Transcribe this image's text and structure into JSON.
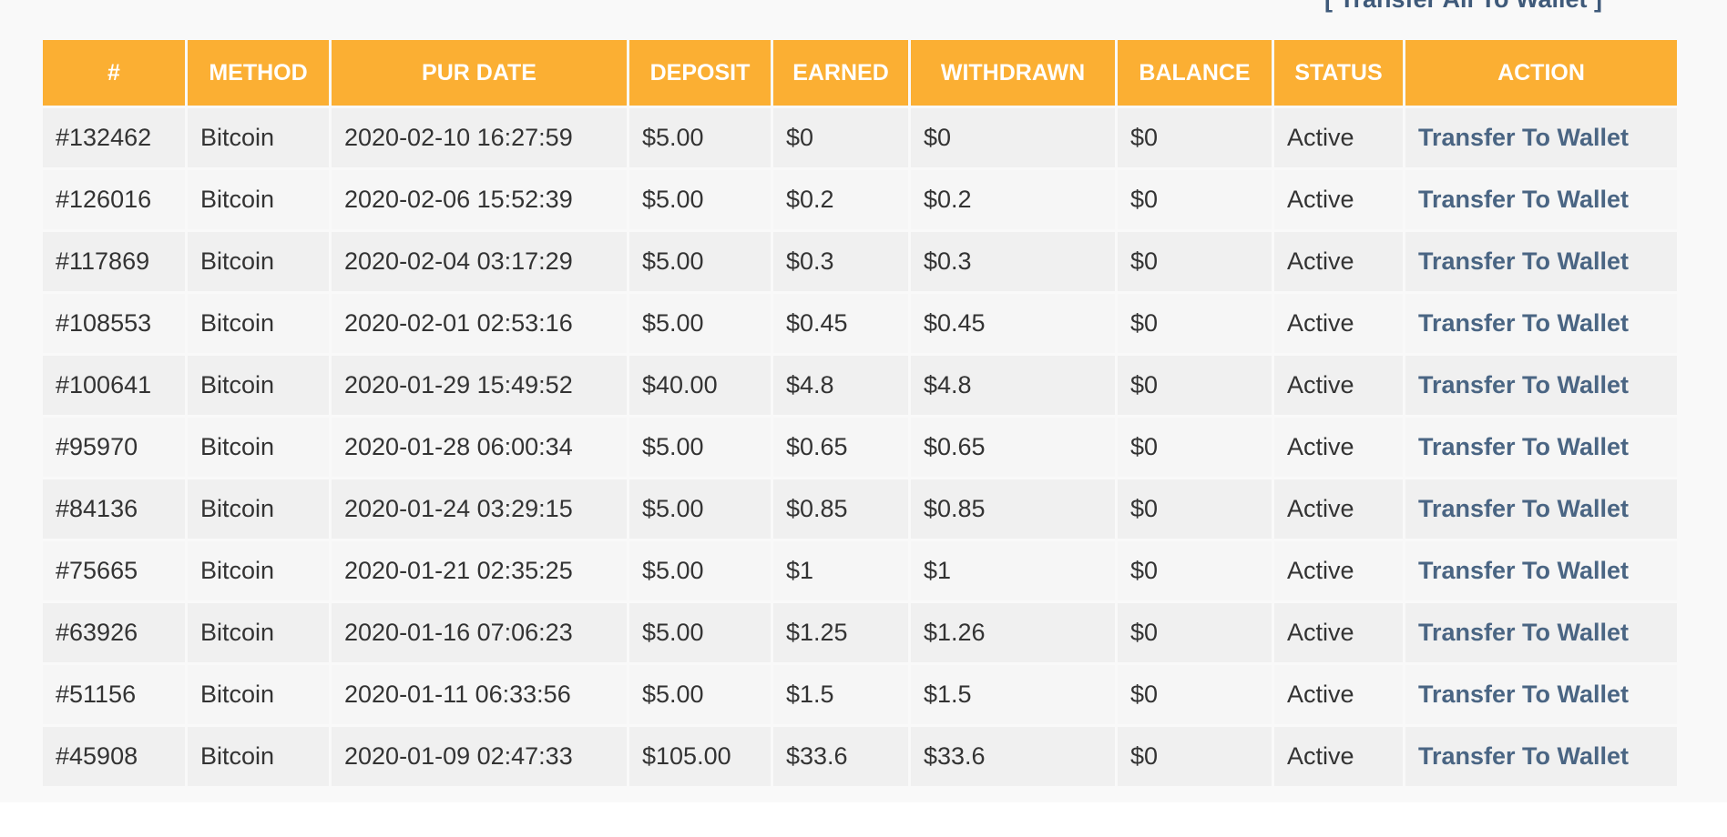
{
  "actions": {
    "transfer_all_label": "[ Transfer All To Wallet ]"
  },
  "table": {
    "headers": [
      "#",
      "METHOD",
      "PUR DATE",
      "DEPOSIT",
      "EARNED",
      "WITHDRAWN",
      "BALANCE",
      "STATUS",
      "ACTION"
    ],
    "rows": [
      [
        "#132462",
        "Bitcoin",
        "2020-02-10 16:27:59",
        "$5.00",
        "$0",
        "$0",
        "$0",
        "Active",
        "Transfer To Wallet"
      ],
      [
        "#126016",
        "Bitcoin",
        "2020-02-06 15:52:39",
        "$5.00",
        "$0.2",
        "$0.2",
        "$0",
        "Active",
        "Transfer To Wallet"
      ],
      [
        "#117869",
        "Bitcoin",
        "2020-02-04 03:17:29",
        "$5.00",
        "$0.3",
        "$0.3",
        "$0",
        "Active",
        "Transfer To Wallet"
      ],
      [
        "#108553",
        "Bitcoin",
        "2020-02-01 02:53:16",
        "$5.00",
        "$0.45",
        "$0.45",
        "$0",
        "Active",
        "Transfer To Wallet"
      ],
      [
        "#100641",
        "Bitcoin",
        "2020-01-29 15:49:52",
        "$40.00",
        "$4.8",
        "$4.8",
        "$0",
        "Active",
        "Transfer To Wallet"
      ],
      [
        "#95970",
        "Bitcoin",
        "2020-01-28 06:00:34",
        "$5.00",
        "$0.65",
        "$0.65",
        "$0",
        "Active",
        "Transfer To Wallet"
      ],
      [
        "#84136",
        "Bitcoin",
        "2020-01-24 03:29:15",
        "$5.00",
        "$0.85",
        "$0.85",
        "$0",
        "Active",
        "Transfer To Wallet"
      ],
      [
        "#75665",
        "Bitcoin",
        "2020-01-21 02:35:25",
        "$5.00",
        "$1",
        "$1",
        "$0",
        "Active",
        "Transfer To Wallet"
      ],
      [
        "#63926",
        "Bitcoin",
        "2020-01-16 07:06:23",
        "$5.00",
        "$1.25",
        "$1.26",
        "$0",
        "Active",
        "Transfer To Wallet"
      ],
      [
        "#51156",
        "Bitcoin",
        "2020-01-11 06:33:56",
        "$5.00",
        "$1.5",
        "$1.5",
        "$0",
        "Active",
        "Transfer To Wallet"
      ],
      [
        "#45908",
        "Bitcoin",
        "2020-01-09 02:47:33",
        "$105.00",
        "$33.6",
        "$33.6",
        "$0",
        "Active",
        "Transfer To Wallet"
      ]
    ]
  },
  "colors": {
    "header_bg": "#fbaf33",
    "header_text": "#ffffff",
    "row_odd": "#f0f0f0",
    "row_even": "#f6f6f6",
    "link": "#4a6583"
  }
}
